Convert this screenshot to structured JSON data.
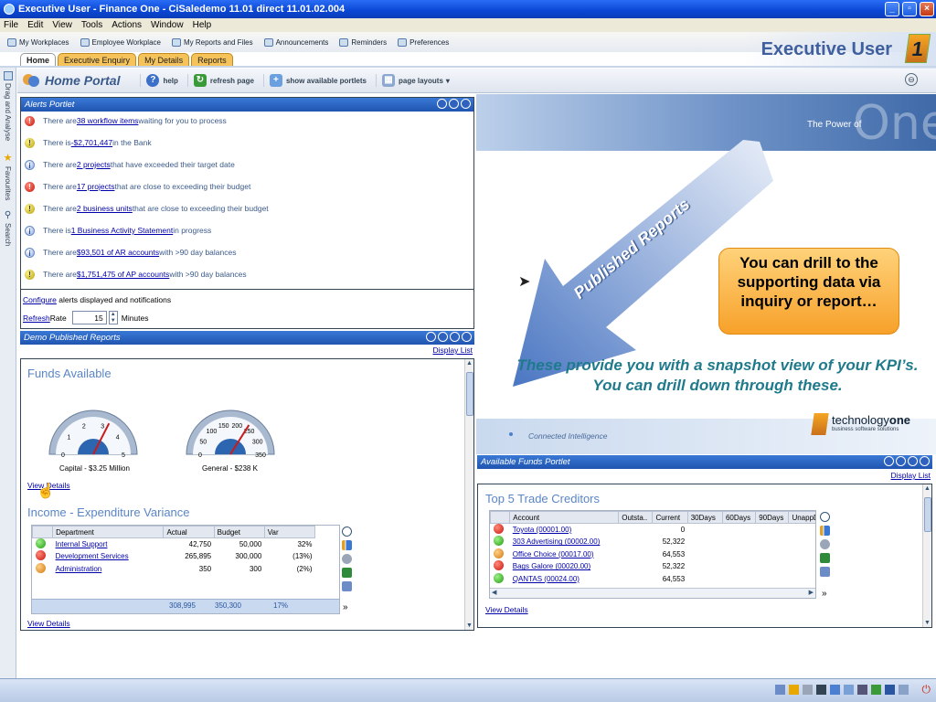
{
  "window": {
    "title": "Executive User - Finance One - CiSaledemo 11.01 direct 11.01.02.004"
  },
  "menu": [
    "File",
    "Edit",
    "View",
    "Tools",
    "Actions",
    "Window",
    "Help"
  ],
  "toolbar": [
    "My Workplaces",
    "Employee Workplace",
    "My Reports and Files",
    "Announcements",
    "Reminders",
    "Preferences"
  ],
  "brand": {
    "user": "Executive User"
  },
  "tabs": [
    "Home",
    "Executive Enquiry",
    "My Details",
    "Reports"
  ],
  "side_tabs": [
    "Drag and Analyse",
    "Favourites",
    "Search"
  ],
  "portal": {
    "title": "Home Portal",
    "help": "help",
    "refresh": "refresh page",
    "portlets": "show available portlets",
    "layouts": "page layouts"
  },
  "alerts": {
    "title": "Alerts Portlet",
    "items": [
      {
        "level": "red",
        "pre": "There are ",
        "link": "38 workflow items",
        "post": " waiting for you to process"
      },
      {
        "level": "yellow",
        "pre": "There is ",
        "link": "-$2,701,447",
        "post": " in the Bank"
      },
      {
        "level": "blue",
        "pre": "There are ",
        "link": "2 projects",
        "post": " that have exceeded their target date"
      },
      {
        "level": "red",
        "pre": "There are ",
        "link": "17 projects",
        "post": " that are close to exceeding their budget"
      },
      {
        "level": "yellow",
        "pre": "There are ",
        "link": "2 business units",
        "post": " that are close to exceeding their budget"
      },
      {
        "level": "blue",
        "pre": "There is ",
        "link": "1 Business Activity Statement",
        "post": " in progress"
      },
      {
        "level": "blue",
        "pre": "There are ",
        "link": "$93,501 of AR accounts",
        "post": " with >90 day balances"
      },
      {
        "level": "yellow",
        "pre": "There are ",
        "link": "$1,751,475 of AP accounts",
        "post": " with >90 day balances"
      }
    ],
    "configure_link": "Configure",
    "configure_text": " alerts displayed and notifications",
    "refresh_link": "Refresh",
    "rate_label": " Rate",
    "rate_value": "15",
    "minutes": "Minutes"
  },
  "published": {
    "title": "Demo Published Reports",
    "display_list": "Display List",
    "funds_title": "Funds Available",
    "gauge1": {
      "label": "Capital - $3.25 Million",
      "ticks": [
        "0",
        "1",
        "2",
        "3",
        "4",
        "5"
      ],
      "value": 3.25
    },
    "gauge2": {
      "label": "General - $238 K",
      "ticks": [
        "0",
        "50",
        "100",
        "150",
        "200",
        "250",
        "300",
        "350"
      ],
      "value": 238
    },
    "view_details": "View Details",
    "variance_title": "Income - Expenditure Variance",
    "variance_headers": [
      "Department",
      "Actual",
      "Budget",
      "Var"
    ],
    "variance_rows": [
      {
        "status": "green",
        "dept": "Internal Support",
        "actual": "42,750",
        "budget": "50,000",
        "var": "32%"
      },
      {
        "status": "red",
        "dept": "Development Services",
        "actual": "265,895",
        "budget": "300,000",
        "var": "(13%)"
      },
      {
        "status": "orange",
        "dept": "Administration",
        "actual": "350",
        "budget": "300",
        "var": "(2%)"
      }
    ],
    "variance_totals": {
      "actual": "308,995",
      "budget": "350,300",
      "var": "17%"
    },
    "view_details2": "View Details"
  },
  "banner": {
    "tagline": "The Power of",
    "arrow_text": "Published Reports",
    "callout": "You can drill to the supporting data via inquiry or report…",
    "snapshot": "These provide you with a snapshot view of your KPI’s.   You can drill down through these.",
    "connected": "Connected Intelligence",
    "logo_main": "technology",
    "logo_bold": "one",
    "logo_sub": "business software solutions"
  },
  "funds_portlet": {
    "title": "Available Funds Portlet",
    "display_list": "Display List",
    "creditors_title": "Top 5 Trade Creditors",
    "headers": [
      "Account",
      "Outsta..",
      "Current",
      "30Days",
      "60Days",
      "90Days",
      "UnappD"
    ],
    "rows": [
      {
        "status": "red",
        "account": "Toyota (00001.00)",
        "current": "0"
      },
      {
        "status": "green",
        "account": "303 Advertising (00002.00)",
        "current": "52,322"
      },
      {
        "status": "orange",
        "account": "Office Choice (00017.00)",
        "current": "64,553"
      },
      {
        "status": "red",
        "account": "Bags Galore (00020.00)",
        "current": "52,322"
      },
      {
        "status": "green",
        "account": "QANTAS (00024.00)",
        "current": "64,553"
      }
    ],
    "view_details": "View Details"
  },
  "more": "»"
}
